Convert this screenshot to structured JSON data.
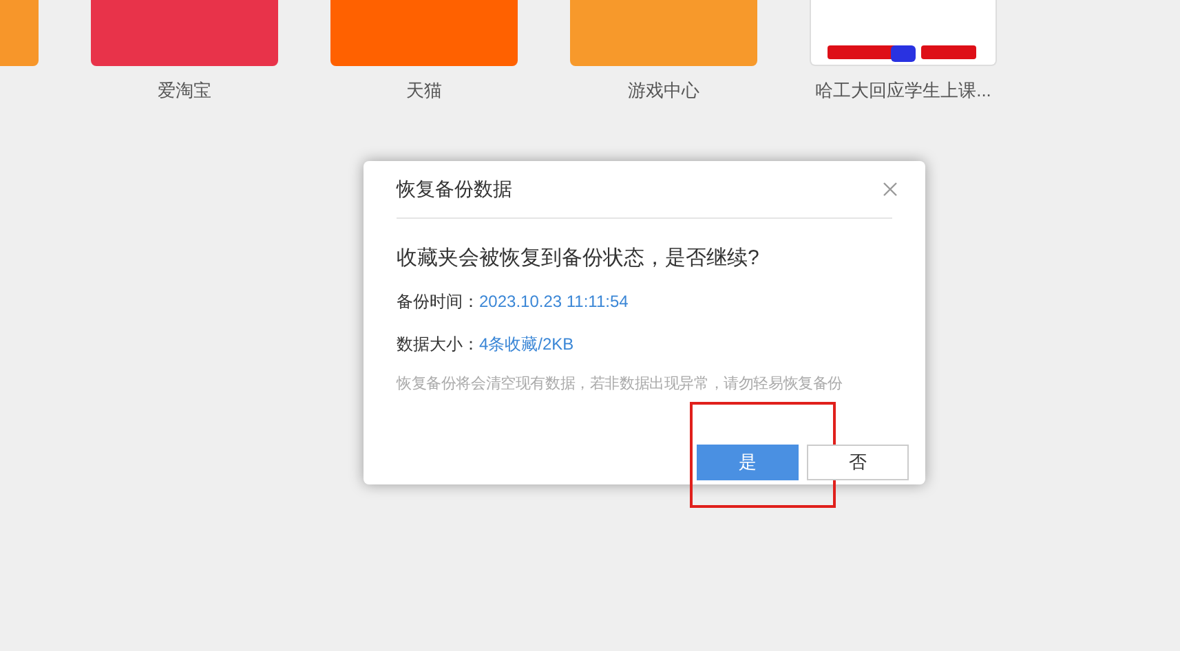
{
  "tiles": [
    {
      "kind": "plain",
      "color": "#f7962a"
    },
    {
      "kind": "plain",
      "color": "#e8334a",
      "label": "爱淘宝"
    },
    {
      "kind": "plain",
      "color": "#ff6100",
      "label": "天猫"
    },
    {
      "kind": "plain",
      "color": "#f7992b",
      "label": "游戏中心"
    },
    {
      "kind": "logo",
      "color": "#ffffff",
      "label": "哈工大回应学生上课..."
    }
  ],
  "dialog": {
    "title": "恢复备份数据",
    "question": "收藏夹会被恢复到备份状态，是否继续?",
    "details": [
      {
        "label": "备份时间：",
        "value": "2023.10.23 11:11:54"
      },
      {
        "label": "数据大小：",
        "value": "4条收藏/2KB"
      }
    ],
    "warning": "恢复备份将会清空现有数据，若非数据出现异常，请勿轻易恢复备份",
    "buttons": [
      {
        "label": "是",
        "primary": true,
        "highlighted": true
      },
      {
        "label": "否",
        "primary": false,
        "highlighted": false
      }
    ]
  }
}
